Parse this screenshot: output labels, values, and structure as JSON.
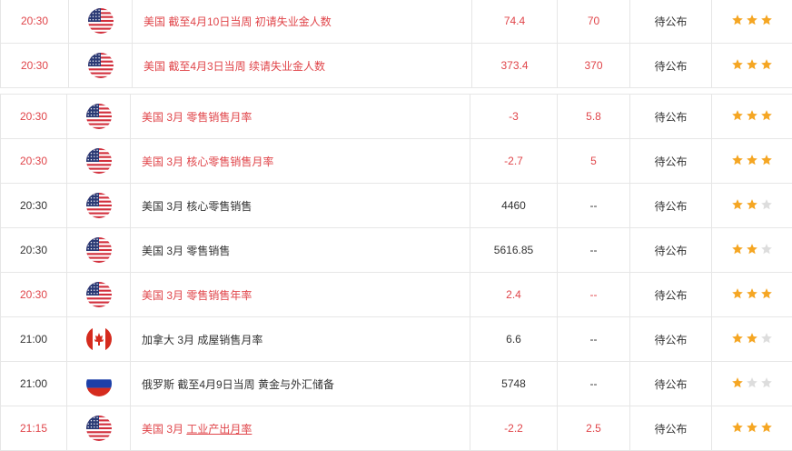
{
  "top_rows": [
    {
      "time": "20:30",
      "country": "us-flag-icon",
      "event": "美国 截至4月10日当周 初请失业金人数",
      "actual": "74.4",
      "prev": "70",
      "status": "待公布",
      "stars": 3,
      "red": true
    },
    {
      "time": "20:30",
      "country": "us-flag-icon",
      "event": "美国 截至4月3日当周 续请失业金人数",
      "actual": "373.4",
      "prev": "370",
      "status": "待公布",
      "stars": 3,
      "red": true
    }
  ],
  "rows": [
    {
      "time": "20:30",
      "country": "us-flag-icon",
      "event": "美国 3月 零售销售月率",
      "actual": "-3",
      "prev": "5.8",
      "status": "待公布",
      "stars": 3,
      "red": true
    },
    {
      "time": "20:30",
      "country": "us-flag-icon",
      "event": "美国 3月 核心零售销售月率",
      "actual": "-2.7",
      "prev": "5",
      "status": "待公布",
      "stars": 3,
      "red": true
    },
    {
      "time": "20:30",
      "country": "us-flag-icon",
      "event": "美国 3月 核心零售销售",
      "actual": "4460",
      "prev": "--",
      "status": "待公布",
      "stars": 2,
      "red": false
    },
    {
      "time": "20:30",
      "country": "us-flag-icon",
      "event": "美国 3月 零售销售",
      "actual": "5616.85",
      "prev": "--",
      "status": "待公布",
      "stars": 2,
      "red": false
    },
    {
      "time": "20:30",
      "country": "us-flag-icon",
      "event": "美国 3月 零售销售年率",
      "actual": "2.4",
      "prev": "--",
      "status": "待公布",
      "stars": 3,
      "red": true
    },
    {
      "time": "21:00",
      "country": "canada-flag-icon",
      "event": "加拿大 3月 成屋销售月率",
      "actual": "6.6",
      "prev": "--",
      "status": "待公布",
      "stars": 2,
      "red": false
    },
    {
      "time": "21:00",
      "country": "russia-flag-icon",
      "event": "俄罗斯 截至4月9日当周 黄金与外汇储备",
      "actual": "5748",
      "prev": "--",
      "status": "待公布",
      "stars": 1,
      "red": false
    },
    {
      "time": "21:15",
      "country": "us-flag-icon",
      "event_prefix": "美国 3月 ",
      "event_link": "工业产出月率",
      "actual": "-2.2",
      "prev": "2.5",
      "status": "待公布",
      "stars": 3,
      "red": true
    }
  ],
  "colors": {
    "red": "#e0454a",
    "star_on": "#f5a623",
    "star_off": "#dddddd",
    "border": "#e6e6e6"
  }
}
